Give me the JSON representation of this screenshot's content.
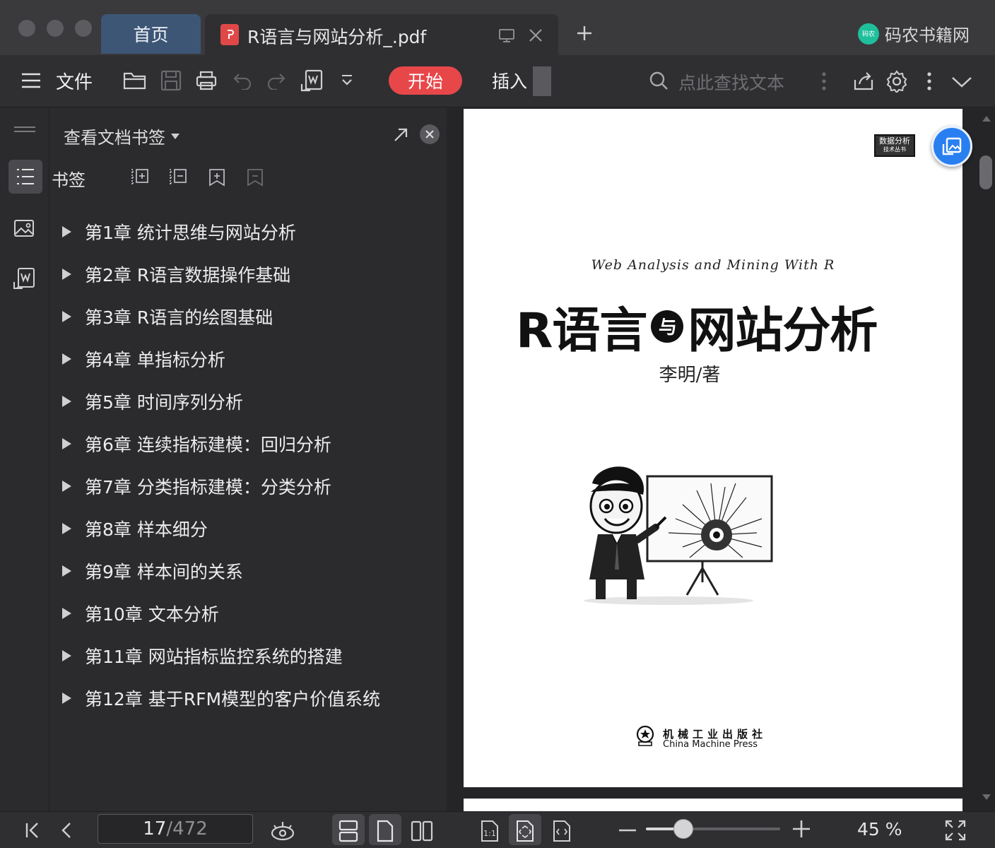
{
  "titlebar": {
    "home_tab": "首页",
    "doc_tab_title": "R语言与网站分析_.pdf",
    "site_brand": "码农书籍网",
    "site_brand_badge": "码农"
  },
  "toolbar": {
    "file_menu": "文件",
    "start_tab": "开始",
    "insert_tab": "插入",
    "search_placeholder": "点此查找文本"
  },
  "bookmark_panel": {
    "title": "查看文档书签",
    "bookmarks_label": "书签",
    "items": [
      "第1章 统计思维与网站分析",
      "第2章 R语言数据操作基础",
      "第3章 R语言的绘图基础",
      "第4章 单指标分析",
      "第5章 时间序列分析",
      "第6章 连续指标建模：回归分析",
      "第7章 分类指标建模：分类分析",
      "第8章 样本细分",
      "第9章 样本间的关系",
      "第10章 文本分析",
      "第11章 网站指标监控系统的搭建",
      "第12章 基于RFM模型的客户价值系统"
    ]
  },
  "document": {
    "subtitle_en": "Web Analysis and Mining With R",
    "title_left": "R语言",
    "title_mid": "与",
    "title_right": "网站分析",
    "author": "李明/著",
    "series_badge_line1": "数据分析",
    "series_badge_line2": "技术丛书",
    "publisher_cn": "机械工业出版社",
    "publisher_en": "China Machine Press"
  },
  "statusbar": {
    "current_page": "17",
    "total_pages": "/472",
    "zoom_label": "45 %",
    "zoom_fraction": 0.28
  },
  "colors": {
    "accent_red": "#e8474a",
    "home_tab_blue": "#3d5675",
    "fab_blue": "#2a7ff0"
  }
}
